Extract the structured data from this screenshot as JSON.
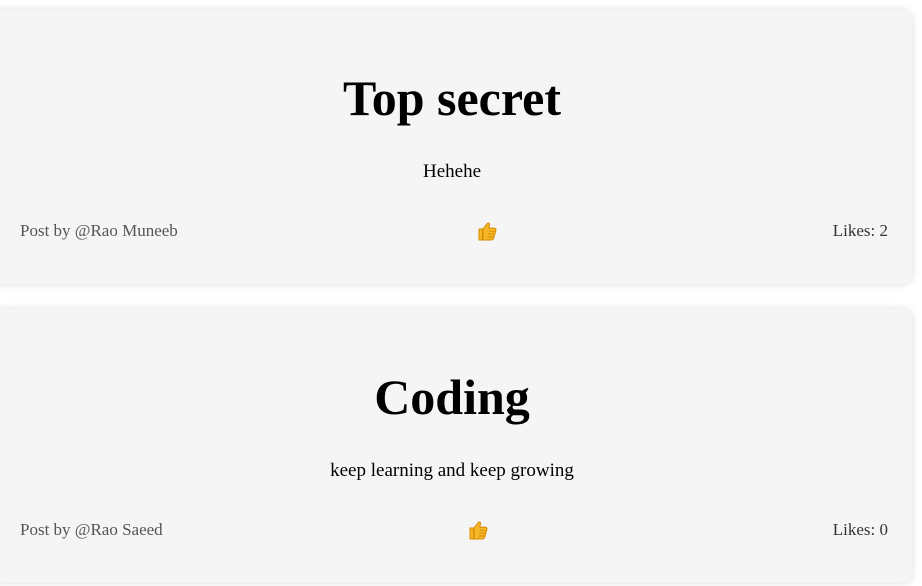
{
  "posts": [
    {
      "title": "Top secret",
      "body": "Hehehe",
      "author": "Post by @Rao Muneeb",
      "likes": "Likes: 2",
      "like_icon": "thumbs-up-icon"
    },
    {
      "title": "Coding",
      "body": "keep learning and keep growing",
      "author": "Post by @Rao Saeed",
      "likes": "Likes: 0",
      "like_icon": "thumbs-up-icon"
    }
  ],
  "colors": {
    "card_background": "#f5f5f5",
    "title_text": "#000000",
    "author_text": "#555555",
    "likes_text": "#333333",
    "thumb_fill": "#f6b728",
    "thumb_stroke": "#d78a00"
  }
}
